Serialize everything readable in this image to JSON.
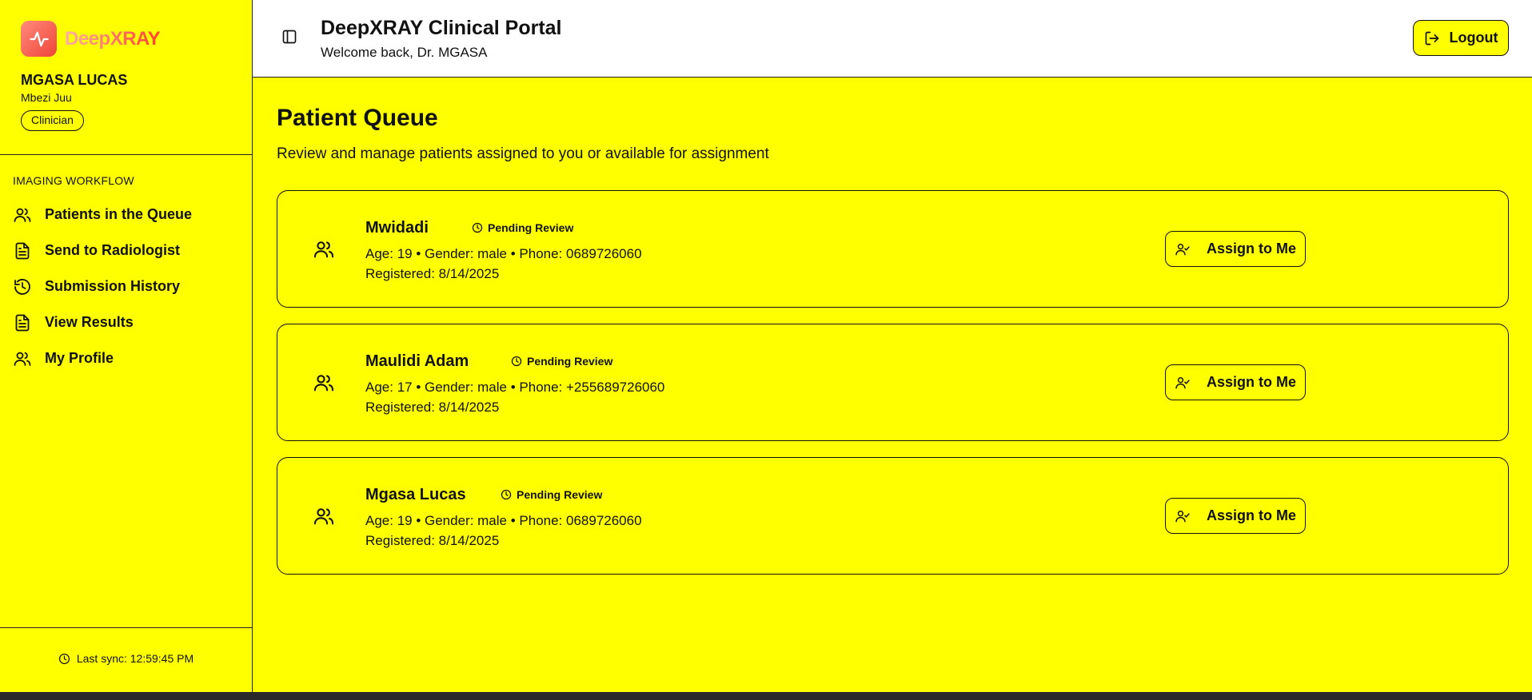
{
  "sidebar": {
    "brand": "DeepXRAY",
    "user_name": "MGASA LUCAS",
    "user_location": "Mbezi Juu",
    "role": "Clinician",
    "section_label": "IMAGING WORKFLOW",
    "items": [
      {
        "label": "Patients in the Queue",
        "icon": "users-icon"
      },
      {
        "label": "Send to Radiologist",
        "icon": "file-text-icon"
      },
      {
        "label": "Submission History",
        "icon": "history-icon"
      },
      {
        "label": "View Results",
        "icon": "file-text-icon"
      },
      {
        "label": "My Profile",
        "icon": "users-icon"
      }
    ],
    "last_sync": "Last sync: 12:59:45 PM"
  },
  "header": {
    "title": "DeepXRAY Clinical Portal",
    "welcome": "Welcome back, Dr. MGASA",
    "logout_label": "Logout"
  },
  "main": {
    "title": "Patient Queue",
    "subtitle": "Review and manage patients assigned to you or available for assignment",
    "patients": [
      {
        "name": "Mwidadi",
        "status": "Pending Review",
        "details": "Age: 19 • Gender: male • Phone: 0689726060",
        "registered": "Registered: 8/14/2025",
        "action": "Assign to Me"
      },
      {
        "name": "Maulidi Adam",
        "status": "Pending Review",
        "details": "Age: 17 • Gender: male • Phone: +255689726060",
        "registered": "Registered: 8/14/2025",
        "action": "Assign to Me"
      },
      {
        "name": "Mgasa Lucas",
        "status": "Pending Review",
        "details": "Age: 19 • Gender: male • Phone: 0689726060",
        "registered": "Registered: 8/14/2025",
        "action": "Assign to Me"
      }
    ]
  },
  "colors": {
    "background": "#ffff00",
    "header": "#ffffff",
    "brand_gradient_start": "#ffb0a8",
    "brand_gradient_end": "#ff4030"
  }
}
